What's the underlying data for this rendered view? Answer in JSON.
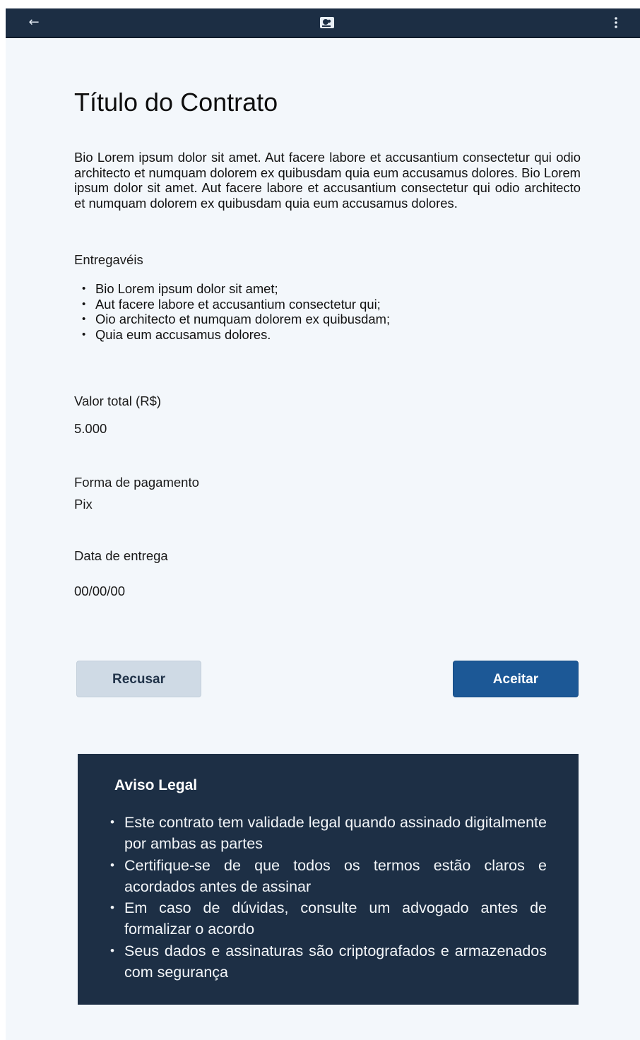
{
  "topbar": {
    "back_icon": "arrow-left-icon",
    "logo_icon": "app-logo-icon",
    "menu_icon": "more-vertical-icon",
    "back_glyph": "←"
  },
  "contract": {
    "title": "Título do Contrato",
    "bio": "Bio Lorem ipsum dolor sit amet. Aut facere labore et accusantium consectetur qui odio architecto et numquam dolorem ex quibusdam quia eum accusamus dolores. Bio Lorem ipsum dolor sit amet. Aut facere labore et accusantium consectetur qui odio architecto et numquam dolorem ex quibusdam quia eum accusamus dolores.",
    "deliverables_label": "Entregavéis",
    "deliverables": [
      "Bio Lorem ipsum dolor sit amet;",
      "Aut facere labore et accusantium consectetur qui;",
      "Oio architecto et numquam dolorem ex quibusdam;",
      "Quia eum accusamus dolores."
    ],
    "total_label": "Valor total (R$)",
    "total_value": "5.000",
    "payment_label": "Forma de pagamento",
    "payment_value": "Pix",
    "delivery_label": "Data de entrega",
    "delivery_value": "00/00/00"
  },
  "actions": {
    "refuse_label": "Recusar",
    "accept_label": "Aceitar"
  },
  "legal": {
    "title": "Aviso Legal",
    "items": [
      "Este contrato tem validade legal quando assinado digitalmente por ambas as partes",
      "Certifique-se de que todos os termos estão claros e acordados antes de assinar",
      "Em caso de dúvidas, consulte um advogado antes de formalizar o acordo",
      "Seus dados e assinaturas são criptografados e armazenados com segurança"
    ]
  },
  "colors": {
    "topbar_bg": "#1c2e44",
    "page_bg": "#f3f7fb",
    "accept_bg": "#1c5896",
    "refuse_bg": "#cfdae5",
    "legal_bg": "#1d2f45"
  }
}
